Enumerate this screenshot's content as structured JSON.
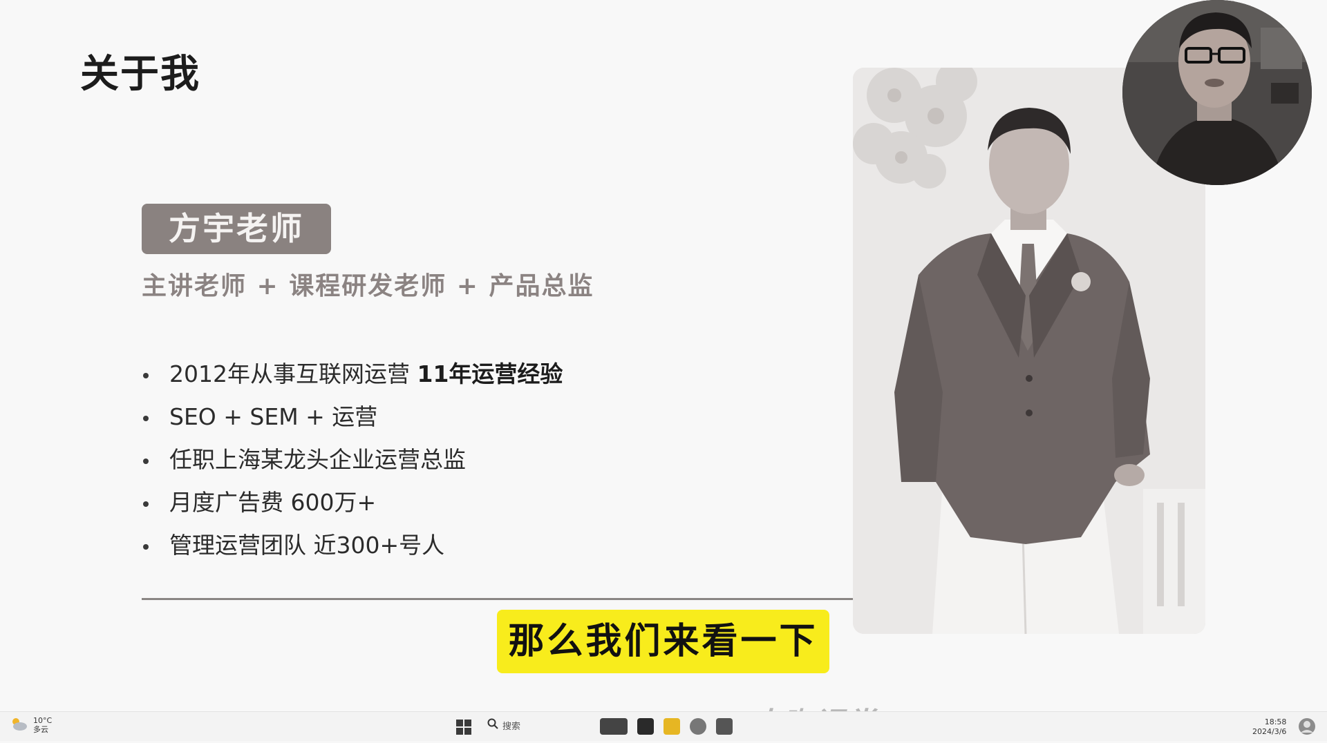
{
  "slide": {
    "title": "关于我",
    "name_badge": "方宇老师",
    "subtitle": "主讲老师 + 课程研发老师 + 产品总监",
    "bullets": [
      {
        "text": "2012年从事互联网运营 ",
        "bold": "11年运营经验"
      },
      {
        "text": "SEO + SEM + 运营",
        "bold": ""
      },
      {
        "text": "任职上海某龙头企业运营总监",
        "bold": ""
      },
      {
        "text": "月度广告费 600万+",
        "bold": ""
      },
      {
        "text": "管理运营团队 近300+号人",
        "bold": ""
      }
    ]
  },
  "caption": "那么我们来看一下",
  "watermark": "大咖课堂",
  "taskbar": {
    "weather_temp": "10°C",
    "weather_desc": "多云",
    "search_label": "搜索",
    "time": "18:58",
    "date": "2024/3/6"
  },
  "colors": {
    "badge": "#8a8280",
    "subtitle": "#8b8382",
    "caption_bg": "#f8ec1c",
    "divider": "#8a8684"
  },
  "icons": [
    "weather-cloud-icon",
    "windows-start-icon",
    "search-icon",
    "file-explorer-icon",
    "browser-icon",
    "app-icon",
    "folder-icon",
    "chrome-icon",
    "notepad-icon",
    "user-avatar-icon"
  ]
}
